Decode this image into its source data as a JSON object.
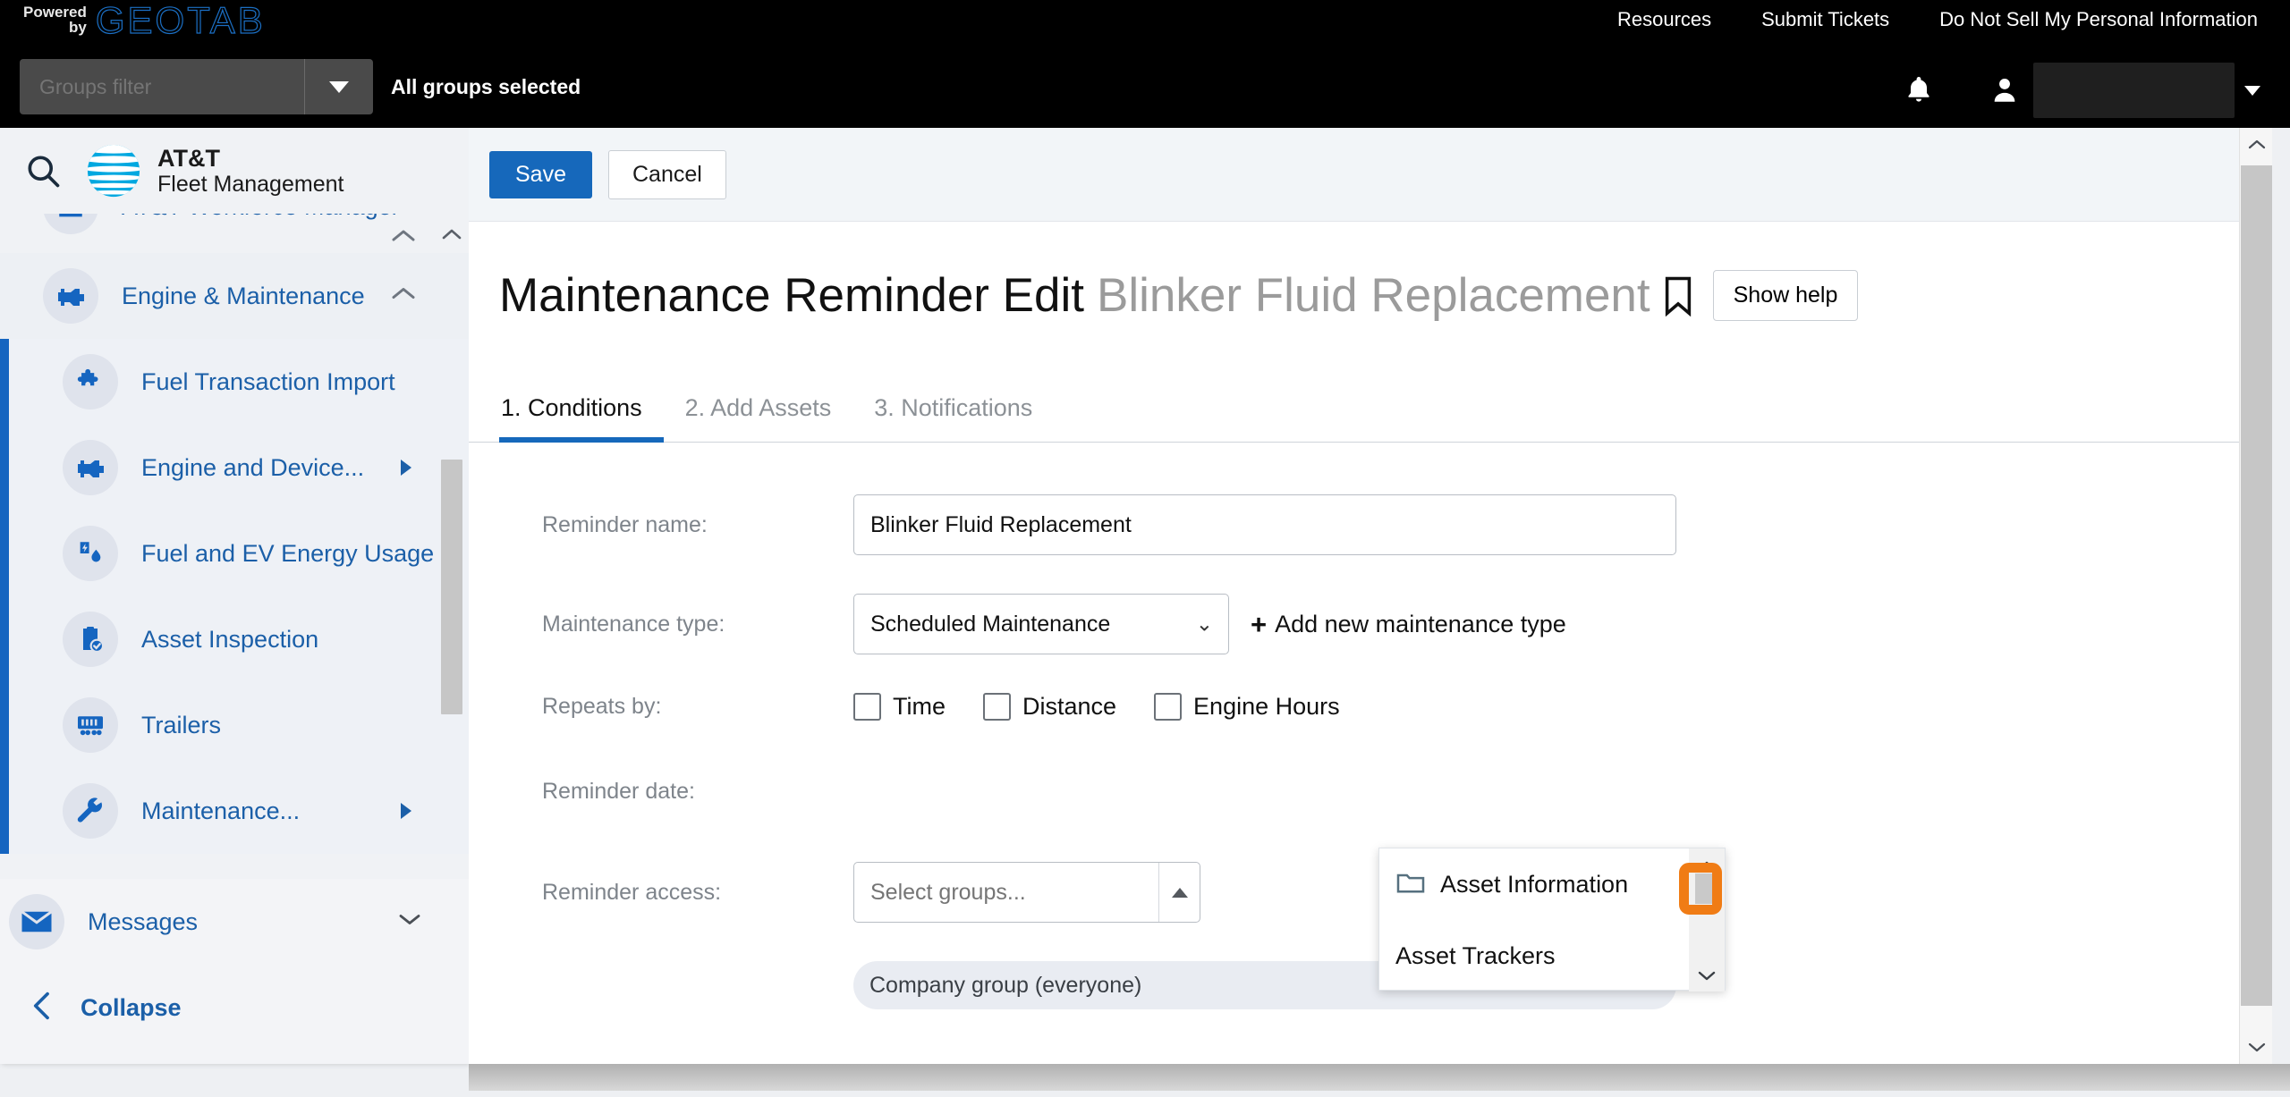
{
  "topbar": {
    "powered_by_line1": "Powered",
    "powered_by_line2": "by",
    "brand_logo": "GEOTAB",
    "nav": [
      {
        "label": "Resources"
      },
      {
        "label": "Submit Tickets"
      },
      {
        "label": "Do Not Sell My Personal Information"
      }
    ],
    "groups_filter_placeholder": "Groups filter",
    "groups_filter_value": "",
    "all_groups_status": "All groups selected",
    "bell_icon": "bell-icon",
    "person_icon": "person-icon",
    "user_name": ""
  },
  "sidebar": {
    "search_icon": "search-icon",
    "brand_line1": "AT&T",
    "brand_line2": "Fleet Management",
    "items": [
      {
        "label": "AT&T Workforce Manager",
        "icon": "workforce-icon",
        "chevron": "up",
        "clipped": true
      },
      {
        "label": "Engine & Maintenance",
        "icon": "engine-icon",
        "chevron": "up",
        "expanded": true
      },
      {
        "label": "Fuel Transaction Import",
        "icon": "puzzle-icon",
        "sub": true
      },
      {
        "label": "Engine and Device...",
        "icon": "engine-icon",
        "sub": true,
        "chevron": "right"
      },
      {
        "label": "Fuel and EV Energy Usage",
        "icon": "fuel-ev-icon",
        "sub": true
      },
      {
        "label": "Asset Inspection",
        "icon": "clipboard-check-icon",
        "sub": true
      },
      {
        "label": "Trailers",
        "icon": "trailer-icon",
        "sub": true
      },
      {
        "label": "Maintenance...",
        "icon": "wrench-icon",
        "sub": true,
        "chevron": "right"
      }
    ],
    "messages_label": "Messages",
    "messages_icon": "envelope-icon",
    "collapse_label": "Collapse",
    "collapse_icon": "chevron-left-icon"
  },
  "main": {
    "toolbar": {
      "save_label": "Save",
      "cancel_label": "Cancel"
    },
    "title": "Maintenance Reminder Edit",
    "subtitle": "Blinker Fluid Replacement",
    "bookmark_icon": "bookmark-icon",
    "show_help_label": "Show help",
    "tabs": [
      {
        "label": "1. Conditions",
        "active": true
      },
      {
        "label": "2. Add Assets",
        "active": false
      },
      {
        "label": "3. Notifications",
        "active": false
      }
    ],
    "form": {
      "reminder_name_label": "Reminder name:",
      "reminder_name_value": "Blinker Fluid Replacement",
      "maintenance_type_label": "Maintenance type:",
      "maintenance_type_value": "Scheduled Maintenance",
      "maintenance_type_options": [
        "Scheduled Maintenance"
      ],
      "add_new_type_label": "Add new maintenance type",
      "add_new_type_plus": "+",
      "repeats_by_label": "Repeats by:",
      "repeats_by_options": [
        {
          "label": "Time",
          "checked": false
        },
        {
          "label": "Distance",
          "checked": false
        },
        {
          "label": "Engine Hours",
          "checked": false
        }
      ],
      "reminder_date_label": "Reminder date:",
      "reminder_access_label": "Reminder access:",
      "groups_select_placeholder": "Select groups...",
      "groups_select_value": "",
      "selected_group_chip": "Company group (everyone)"
    },
    "dropdown": {
      "items": [
        {
          "label": "Asset Information",
          "icon": "folder-icon"
        },
        {
          "label": "Asset Trackers",
          "icon": ""
        }
      ],
      "scroll_up_icon": "chevron-up-icon",
      "scroll_down_icon": "chevron-down-icon",
      "highlight_color": "#f07c15"
    }
  },
  "colors": {
    "accent_blue": "#1668bb",
    "sidebar_blue": "#1b5fa8",
    "highlight_orange": "#f07c15",
    "geotab_blue": "#1b6fc4"
  }
}
